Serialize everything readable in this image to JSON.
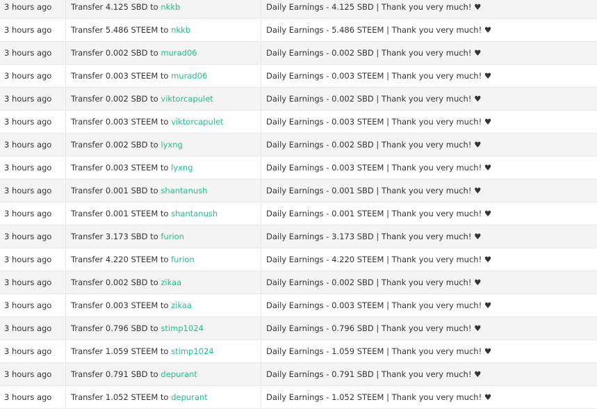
{
  "transfers": [
    {
      "time": "3 hours ago",
      "op_prefix": "Transfer 4.125 SBD to",
      "recipient": "nkkb",
      "memo": "Daily Earnings - 4.125 SBD | Thank you very much! ♥"
    },
    {
      "time": "3 hours ago",
      "op_prefix": "Transfer 5.486 STEEM to",
      "recipient": "nkkb",
      "memo": "Daily Earnings - 5.486 STEEM | Thank you very much! ♥"
    },
    {
      "time": "3 hours ago",
      "op_prefix": "Transfer 0.002 SBD to",
      "recipient": "murad06",
      "memo": "Daily Earnings - 0.002 SBD | Thank you very much! ♥"
    },
    {
      "time": "3 hours ago",
      "op_prefix": "Transfer 0.003 STEEM to",
      "recipient": "murad06",
      "memo": "Daily Earnings - 0.003 STEEM | Thank you very much! ♥"
    },
    {
      "time": "3 hours ago",
      "op_prefix": "Transfer 0.002 SBD to",
      "recipient": "viktorcapulet",
      "memo": "Daily Earnings - 0.002 SBD | Thank you very much! ♥"
    },
    {
      "time": "3 hours ago",
      "op_prefix": "Transfer 0.003 STEEM to",
      "recipient": "viktorcapulet",
      "memo": "Daily Earnings - 0.003 STEEM | Thank you very much! ♥"
    },
    {
      "time": "3 hours ago",
      "op_prefix": "Transfer 0.002 SBD to",
      "recipient": "lyxng",
      "memo": "Daily Earnings - 0.002 SBD | Thank you very much! ♥"
    },
    {
      "time": "3 hours ago",
      "op_prefix": "Transfer 0.003 STEEM to",
      "recipient": "lyxng",
      "memo": "Daily Earnings - 0.003 STEEM | Thank you very much! ♥"
    },
    {
      "time": "3 hours ago",
      "op_prefix": "Transfer 0.001 SBD to",
      "recipient": "shantanush",
      "memo": "Daily Earnings - 0.001 SBD | Thank you very much! ♥"
    },
    {
      "time": "3 hours ago",
      "op_prefix": "Transfer 0.001 STEEM to",
      "recipient": "shantanush",
      "memo": "Daily Earnings - 0.001 STEEM | Thank you very much! ♥"
    },
    {
      "time": "3 hours ago",
      "op_prefix": "Transfer 3.173 SBD to",
      "recipient": "furion",
      "memo": "Daily Earnings - 3.173 SBD | Thank you very much! ♥"
    },
    {
      "time": "3 hours ago",
      "op_prefix": "Transfer 4.220 STEEM to",
      "recipient": "furion",
      "memo": "Daily Earnings - 4.220 STEEM | Thank you very much! ♥"
    },
    {
      "time": "3 hours ago",
      "op_prefix": "Transfer 0.002 SBD to",
      "recipient": "zikaa",
      "memo": "Daily Earnings - 0.002 SBD | Thank you very much! ♥"
    },
    {
      "time": "3 hours ago",
      "op_prefix": "Transfer 0.003 STEEM to",
      "recipient": "zikaa",
      "memo": "Daily Earnings - 0.003 STEEM | Thank you very much! ♥"
    },
    {
      "time": "3 hours ago",
      "op_prefix": "Transfer 0.796 SBD to",
      "recipient": "stimp1024",
      "memo": "Daily Earnings - 0.796 SBD | Thank you very much! ♥"
    },
    {
      "time": "3 hours ago",
      "op_prefix": "Transfer 1.059 STEEM to",
      "recipient": "stimp1024",
      "memo": "Daily Earnings - 1.059 STEEM | Thank you very much! ♥"
    },
    {
      "time": "3 hours ago",
      "op_prefix": "Transfer 0.791 SBD to",
      "recipient": "depurant",
      "memo": "Daily Earnings - 0.791 SBD | Thank you very much! ♥"
    },
    {
      "time": "3 hours ago",
      "op_prefix": "Transfer 1.052 STEEM to",
      "recipient": "depurant",
      "memo": "Daily Earnings - 1.052 STEEM | Thank you very much! ♥"
    }
  ],
  "colors": {
    "link": "#1fbf8f",
    "row_alt": "#f4f4f4",
    "text": "#333333"
  }
}
